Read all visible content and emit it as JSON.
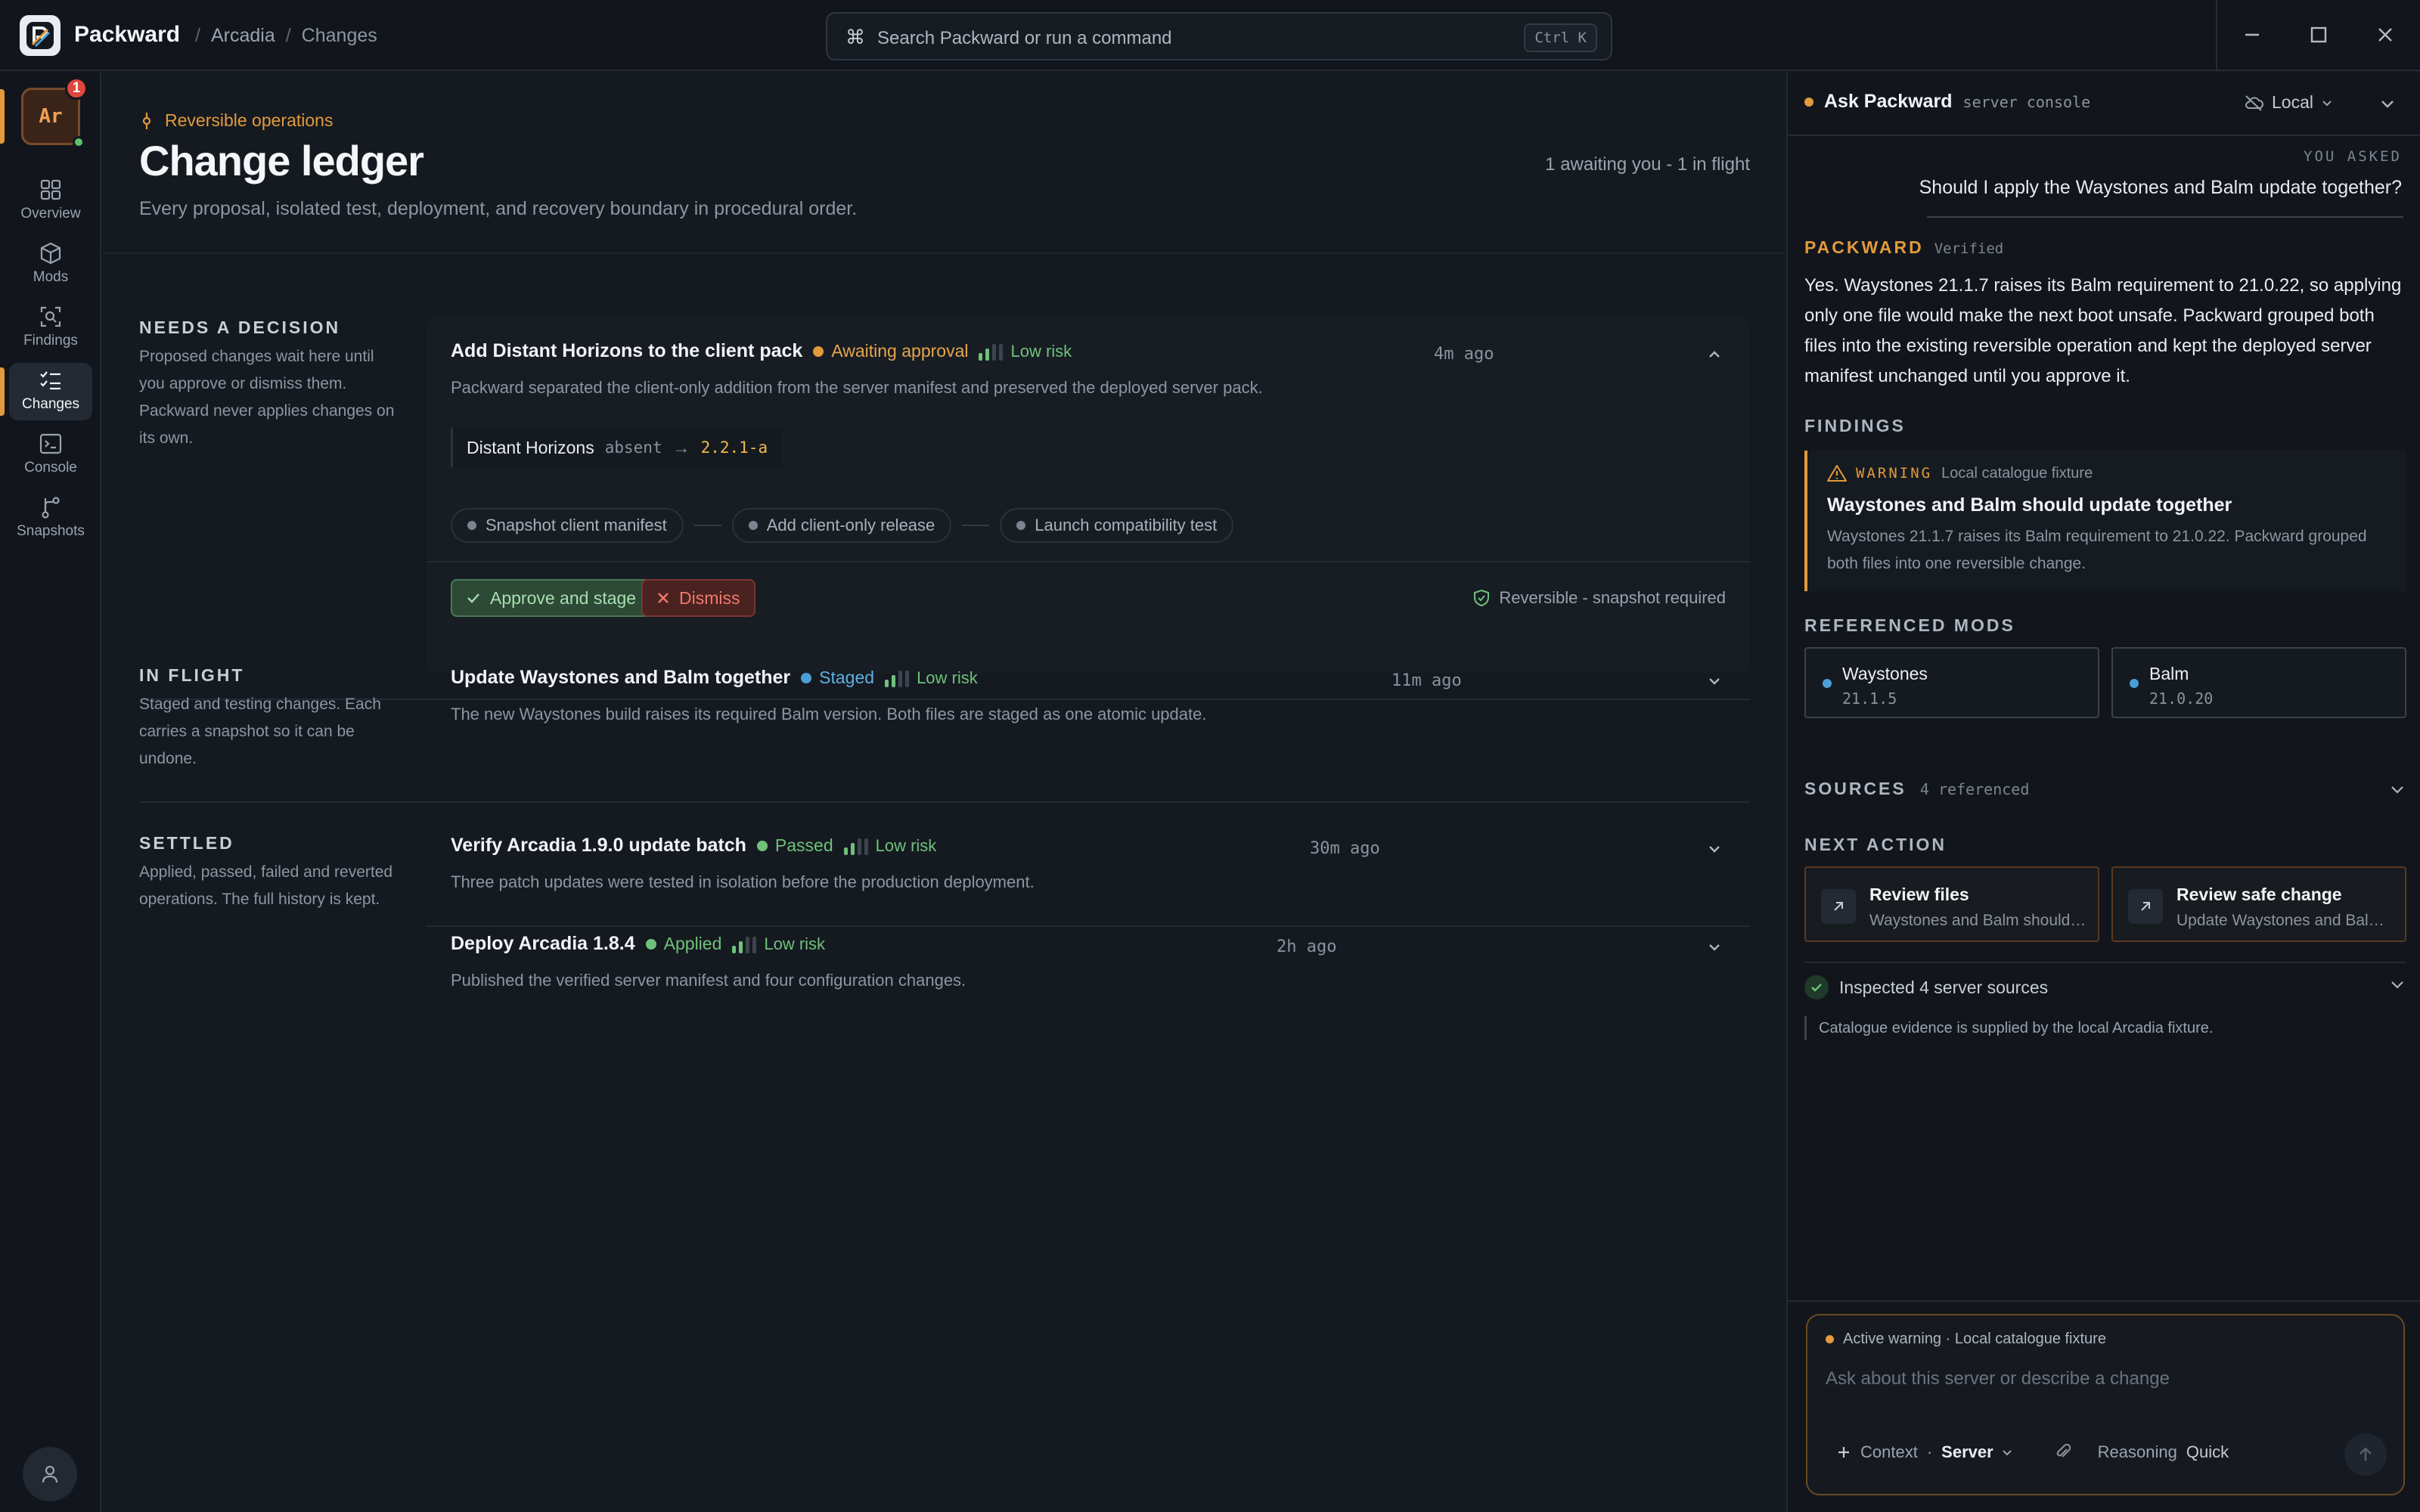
{
  "app": {
    "name": "Packward"
  },
  "breadcrumb": {
    "project": "Arcadia",
    "page": "Changes"
  },
  "search": {
    "placeholder": "Search Packward or run a command",
    "shortcut": "Ctrl K"
  },
  "rail": {
    "server": {
      "initials": "Ar",
      "badge": "1"
    },
    "items": [
      {
        "label": "Overview",
        "icon": "grid-icon"
      },
      {
        "label": "Mods",
        "icon": "cube-icon"
      },
      {
        "label": "Findings",
        "icon": "scan-icon"
      },
      {
        "label": "Changes",
        "icon": "checklist-icon",
        "active": true
      },
      {
        "label": "Console",
        "icon": "terminal-icon"
      },
      {
        "label": "Snapshots",
        "icon": "branch-icon"
      }
    ]
  },
  "page": {
    "eyebrow": "Reversible operations",
    "title": "Change ledger",
    "summary": "1 awaiting you - 1 in flight",
    "subtitle": "Every proposal, isolated test, deployment, and recovery boundary in procedural order."
  },
  "sections": {
    "decision": {
      "heading": "NEEDS A DECISION",
      "description": "Proposed changes wait here until you approve or dismiss them. Packward never applies changes on its own.",
      "card": {
        "title": "Add Distant Horizons to the client pack",
        "status": "Awaiting approval",
        "risk": "Low risk",
        "time": "4m ago",
        "description": "Packward separated the client-only addition from the server manifest and preserved the deployed server pack.",
        "diff": {
          "mod": "Distant Horizons",
          "from": "absent",
          "arrow": "→",
          "to": "2.2.1-a"
        },
        "steps": [
          "Snapshot client manifest",
          "Add client-only release",
          "Launch compatibility test"
        ],
        "approve_label": "Approve and stage",
        "dismiss_label": "Dismiss",
        "reversible_note": "Reversible - snapshot required"
      }
    },
    "inflight": {
      "heading": "IN FLIGHT",
      "description": "Staged and testing changes. Each carries a snapshot so it can be undone.",
      "card": {
        "title": "Update Waystones and Balm together",
        "status": "Staged",
        "risk": "Low risk",
        "time": "11m ago",
        "description": "The new Waystones build raises its required Balm version. Both files are staged as one atomic update."
      }
    },
    "settled": {
      "heading": "SETTLED",
      "description": "Applied, passed, failed and reverted operations. The full history is kept.",
      "cards": [
        {
          "title": "Verify Arcadia 1.9.0 update batch",
          "status": "Passed",
          "risk": "Low risk",
          "time": "30m ago",
          "description": "Three patch updates were tested in isolation before the production deployment."
        },
        {
          "title": "Deploy Arcadia 1.8.4",
          "status": "Applied",
          "risk": "Low risk",
          "time": "2h ago",
          "description": "Published the verified server manifest and four configuration changes."
        }
      ]
    }
  },
  "panel": {
    "title": "Ask Packward",
    "subtitle": "server console",
    "env": "Local",
    "asked_label": "YOU ASKED",
    "question": "Should I apply the Waystones and Balm update together?",
    "answer_label": "PACKWARD",
    "answer_badge": "Verified",
    "answer": "Yes. Waystones 21.1.7 raises its Balm requirement to 21.0.22, so applying only one file would make the next boot unsafe. Packward grouped both files into the existing reversible operation and kept the deployed server manifest unchanged until you approve it.",
    "findings_label": "FINDINGS",
    "finding": {
      "level": "WARNING",
      "source": "Local catalogue fixture",
      "title": "Waystones and Balm should update together",
      "body": "Waystones 21.1.7 raises its Balm requirement to 21.0.22. Packward grouped both files into one reversible change."
    },
    "mods_label": "REFERENCED MODS",
    "mods": [
      {
        "name": "Waystones",
        "version": "21.1.5"
      },
      {
        "name": "Balm",
        "version": "21.0.20"
      }
    ],
    "sources_label": "SOURCES",
    "sources_count": "4 referenced",
    "next_label": "NEXT ACTION",
    "next_actions": [
      {
        "title": "Review files",
        "subtitle": "Waystones and Balm should update together"
      },
      {
        "title": "Review safe change",
        "subtitle": "Update Waystones and Balm together"
      }
    ],
    "inspected": "Inspected 4 server sources",
    "catalogue_note": "Catalogue evidence is supplied by the local Arcadia fixture."
  },
  "composer": {
    "warning": "Active warning · Local catalogue fixture",
    "placeholder": "Ask about this server or describe a change",
    "context_label": "Context",
    "context_sep": "·",
    "context_value": "Server",
    "reasoning_label": "Reasoning",
    "reasoning_value": "Quick"
  },
  "colors": {
    "accent": "#e29a3c",
    "success": "#6fc17a",
    "info": "#4a9fd8",
    "danger": "#ef7a6c",
    "background": "#151a21"
  }
}
